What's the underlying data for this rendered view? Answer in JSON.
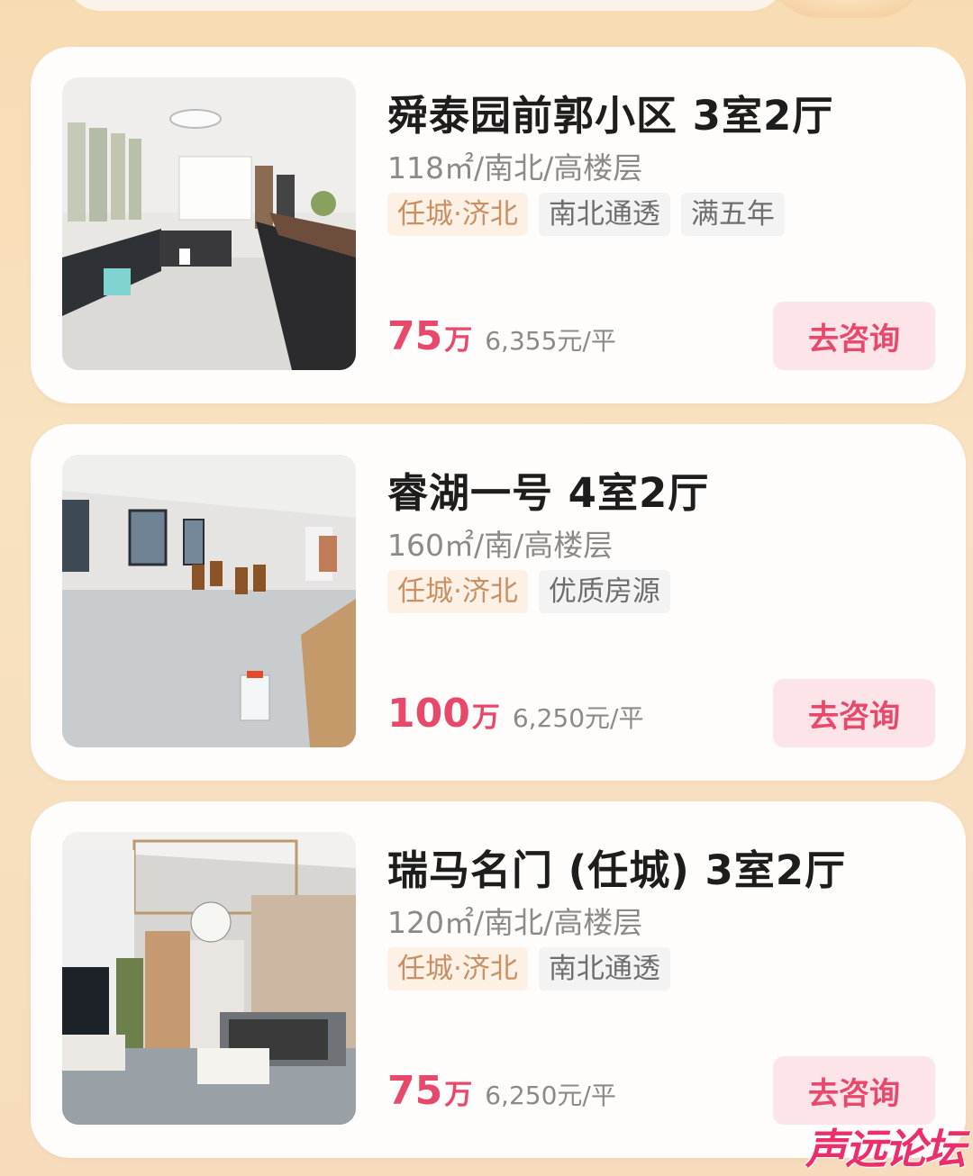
{
  "listings": [
    {
      "title": "舜泰园前郭小区 3室2厅",
      "meta": "118㎡/南北/高楼层",
      "tags": [
        "任城·济北",
        "南北通透",
        "满五年"
      ],
      "price": "75",
      "price_unit": "万",
      "unit_price": "6,355元/平",
      "button": "去咨询"
    },
    {
      "title": "睿湖一号 4室2厅",
      "meta": "160㎡/南/高楼层",
      "tags": [
        "任城·济北",
        "优质房源"
      ],
      "price": "100",
      "price_unit": "万",
      "unit_price": "6,250元/平",
      "button": "去咨询"
    },
    {
      "title": "瑞马名门 (任城) 3室2厅",
      "meta": "120㎡/南北/高楼层",
      "tags": [
        "任城·济北",
        "南北通透"
      ],
      "price": "75",
      "price_unit": "万",
      "unit_price": "6,250元/平",
      "button": "去咨询"
    }
  ],
  "colors": {
    "price": "#e8486a",
    "button_bg": "#fde4e9",
    "location_tag_text": "#c99063",
    "location_tag_bg": "#fdf1e6"
  },
  "watermark": "声远论坛"
}
